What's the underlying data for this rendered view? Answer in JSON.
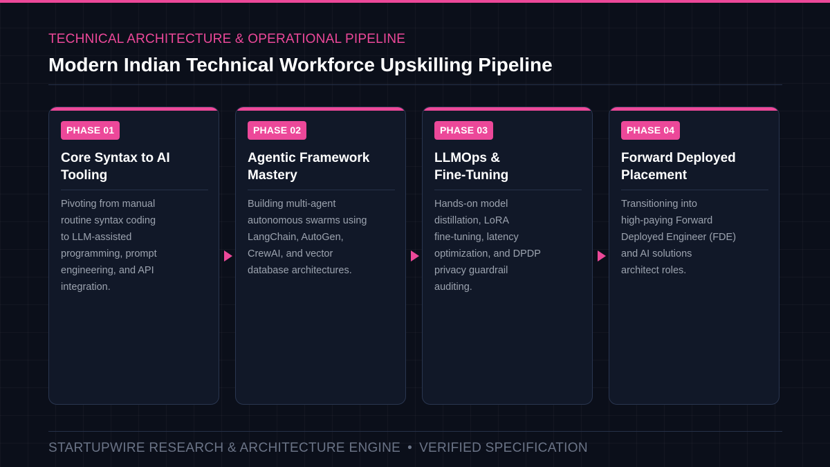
{
  "header": {
    "kicker": "TECHNICAL ARCHITECTURE & OPERATIONAL PIPELINE",
    "title": "Modern Indian Technical Workforce Upskilling Pipeline"
  },
  "phases": [
    {
      "badge": "PHASE 01",
      "title_lines": [
        "Core Syntax to AI",
        "Tooling"
      ],
      "desc_lines": [
        "Pivoting from manual",
        "routine syntax coding",
        "to LLM-assisted",
        "programming, prompt",
        "engineering, and API",
        "integration."
      ]
    },
    {
      "badge": "PHASE 02",
      "title_lines": [
        "Agentic Framework",
        "Mastery"
      ],
      "desc_lines": [
        "Building multi-agent",
        "autonomous swarms using",
        "LangChain, AutoGen,",
        "CrewAI, and vector",
        "database architectures."
      ]
    },
    {
      "badge": "PHASE 03",
      "title_lines": [
        "LLMOps &",
        "Fine-Tuning"
      ],
      "desc_lines": [
        "Hands-on model",
        "distillation, LoRA",
        "fine-tuning, latency",
        "optimization, and DPDP",
        "privacy guardrail",
        "auditing."
      ]
    },
    {
      "badge": "PHASE 04",
      "title_lines": [
        "Forward Deployed",
        "Placement"
      ],
      "desc_lines": [
        "Transitioning into",
        "high-paying Forward",
        "Deployed Engineer (FDE)",
        "and AI solutions",
        "architect roles."
      ]
    }
  ],
  "footer": {
    "left": "STARTUPWIRE RESEARCH & ARCHITECTURE ENGINE",
    "separator": "•",
    "right": "VERIFIED SPECIFICATION"
  },
  "colors": {
    "accent": "#ec4899",
    "background": "#0b0f1a",
    "card": "#111828",
    "muted_text": "#9ca3af"
  }
}
